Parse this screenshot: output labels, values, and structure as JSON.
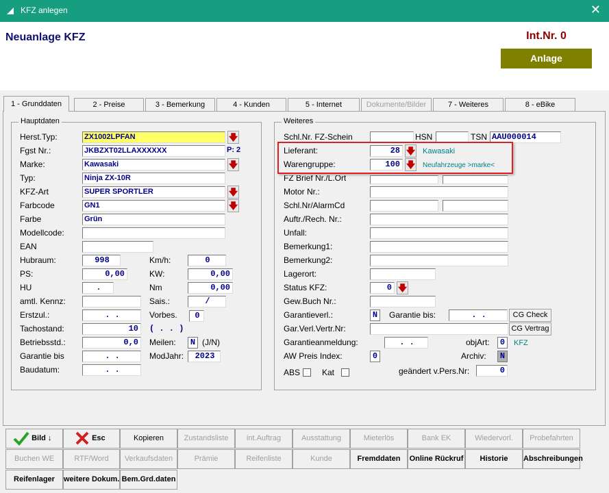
{
  "window": {
    "title": "KFZ anlegen",
    "close": "✕"
  },
  "header": {
    "title": "Neuanlage KFZ",
    "intnr": "Int.Nr. 0",
    "mode": "Anlage"
  },
  "tabs": [
    {
      "label": "1 - Grunddaten",
      "state": "active"
    },
    {
      "label": "2 - Preise",
      "state": "normal"
    },
    {
      "label": "3 - Bemerkung",
      "state": "normal"
    },
    {
      "label": "4 - Kunden",
      "state": "normal"
    },
    {
      "label": "5 - Internet",
      "state": "normal"
    },
    {
      "label": "Dokumente/Bilder",
      "state": "disabled"
    },
    {
      "label": "7 - Weiteres",
      "state": "normal"
    },
    {
      "label": "8 - eBike",
      "state": "normal"
    }
  ],
  "haupt": {
    "title": "Hauptdaten",
    "herst_typ": {
      "label": "Herst.Typ:",
      "value": "ZX1002LPFAN"
    },
    "fgst_nr": {
      "label": "Fgst Nr.:",
      "value": "JKBZXT02LLAXXXXXX",
      "extra": "P: 2"
    },
    "marke": {
      "label": "Marke:",
      "value": "Kawasaki"
    },
    "typ": {
      "label": "Typ:",
      "value": "Ninja ZX-10R"
    },
    "kfz_art": {
      "label": "KFZ-Art",
      "value": "SUPER SPORTLER"
    },
    "farbcode": {
      "label": "Farbcode",
      "value": "GN1"
    },
    "farbe": {
      "label": "Farbe",
      "value": "Grün"
    },
    "modellcode": {
      "label": "Modellcode:",
      "value": ""
    },
    "ean": {
      "label": "EAN",
      "value": ""
    },
    "hubraum": {
      "label": "Hubraum:",
      "value": "998"
    },
    "ps": {
      "label": "PS:",
      "value": "0,00"
    },
    "hu": {
      "label": "HU",
      "value": "."
    },
    "kennz": {
      "label": "amtl. Kennz:",
      "value": ""
    },
    "erstzul": {
      "label": "Erstzul.:",
      "value": ". ."
    },
    "tachostand": {
      "label": "Tachostand:",
      "value": "10"
    },
    "betriebsstd": {
      "label": "Betriebsstd.:",
      "value": "0,0"
    },
    "garantie_bis": {
      "label": "Garantie bis",
      "value": ". ."
    },
    "baudatum": {
      "label": "Baudatum:",
      "value": ". ."
    },
    "kmh": {
      "label": "Km/h:",
      "value": "0"
    },
    "kw": {
      "label": "KW:",
      "value": "0,00"
    },
    "nm": {
      "label": "Nm",
      "value": "0,00"
    },
    "sais": {
      "label": "Sais.:",
      "value": "/"
    },
    "vorbes": {
      "label": "Vorbes.",
      "value": "0"
    },
    "paren": {
      "value": "( . . )"
    },
    "meilen": {
      "label": "Meilen:",
      "value": "N",
      "hint": "(J/N)"
    },
    "modjahr": {
      "label": "ModJahr:",
      "value": "2023"
    }
  },
  "weiteres": {
    "title": "Weiteres",
    "schl_fz": {
      "label": "Schl.Nr. FZ-Schein",
      "hsn_label": "HSN",
      "tsn_label": "TSN",
      "tsn_value": "AAU000014"
    },
    "lieferant": {
      "label": "Lieferant:",
      "value": "28",
      "desc": "Kawasaki"
    },
    "warengruppe": {
      "label": "Warengruppe:",
      "value": "100",
      "desc": "Neufahrzeuge >marke<"
    },
    "fzbrief": {
      "label": "FZ Brief Nr./L.Ort"
    },
    "motor": {
      "label": "Motor Nr.:"
    },
    "alarm": {
      "label": "Schl.Nr/AlarmCd"
    },
    "auftr": {
      "label": "Auftr./Rech. Nr.:"
    },
    "unfall": {
      "label": "Unfall:"
    },
    "bem1": {
      "label": "Bemerkung1:"
    },
    "bem2": {
      "label": "Bemerkung2:"
    },
    "lagerort": {
      "label": "Lagerort:"
    },
    "status": {
      "label": "Status KFZ:",
      "value": "0"
    },
    "gewbuch": {
      "label": "Gew.Buch Nr.:"
    },
    "garantieverl": {
      "label": "Garantieverl.:",
      "value": "N",
      "bis_label": "Garantie bis:",
      "bis_value": ". ."
    },
    "gar_vertr": {
      "label": "Gar.Verl.Vertr.Nr:"
    },
    "garanm": {
      "label": "Garantieanmeldung:",
      "value": ". ."
    },
    "aw": {
      "label": "AW Preis Index:",
      "value": "0"
    },
    "objart": {
      "label": "objArt:",
      "value": "0",
      "desc": "KFZ"
    },
    "archiv": {
      "label": "Archiv:",
      "value": "N"
    },
    "abs": {
      "label": "ABS"
    },
    "kat": {
      "label": "Kat"
    },
    "geaendert": {
      "label": "geändert v.Pers.Nr:",
      "value": "0"
    },
    "cg_check": "CG Check",
    "cg_vertrag": "CG Vertrag"
  },
  "bottom": {
    "row1": [
      "Bild ↓",
      "Esc",
      "Kopieren",
      "Zustandsliste",
      "int.Auftrag",
      "Ausstattung",
      "Mieterlös",
      "Bank EK",
      "Wiedervorl.",
      "Probefahrten"
    ],
    "row2": [
      "Buchen WE",
      "RTF/Word",
      "Verkaufsdaten",
      "Prämie",
      "Reifenliste",
      "Kunde",
      "Fremddaten",
      "Online Rückruf",
      "Historie",
      "Abschreibungen"
    ],
    "row3": [
      "Reifenlager",
      "weitere Dokum.",
      "Bem.Grd.daten"
    ]
  }
}
